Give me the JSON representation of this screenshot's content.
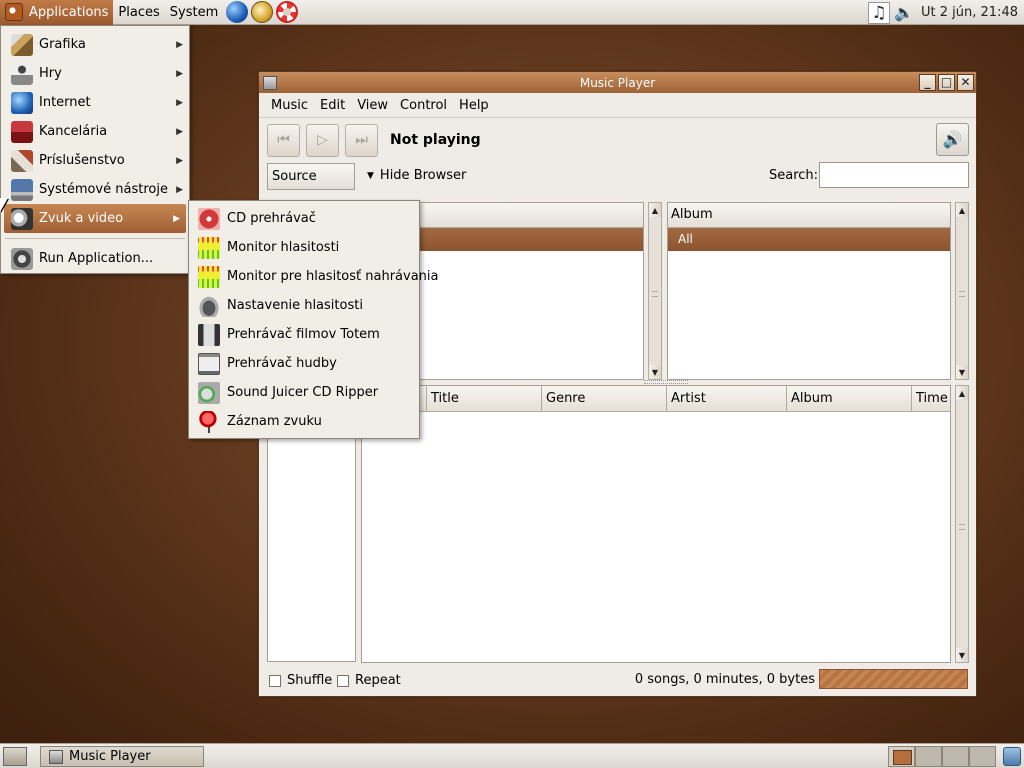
{
  "top_panel": {
    "menus": [
      "Applications",
      "Places",
      "System"
    ],
    "launchers": [
      "globe-icon",
      "mail-icon",
      "help-icon"
    ],
    "tray_icons": [
      "music-note-icon",
      "volume-icon"
    ],
    "clock": "Ut  2 jún, 21:48"
  },
  "apps_menu": {
    "items": [
      {
        "label": "Grafika",
        "icon": "graphics-icon",
        "submenu": true
      },
      {
        "label": "Hry",
        "icon": "games-icon",
        "submenu": true
      },
      {
        "label": "Internet",
        "icon": "internet-icon",
        "submenu": true
      },
      {
        "label": "Kancelária",
        "icon": "office-icon",
        "submenu": true
      },
      {
        "label": "Príslušenstvo",
        "icon": "accessories-icon",
        "submenu": true
      },
      {
        "label": "Systémové nástroje",
        "icon": "system-tools-icon",
        "submenu": true
      },
      {
        "label": "Zvuk a video",
        "icon": "sound-video-icon",
        "submenu": true,
        "selected": true
      }
    ],
    "run_label": "Run Application..."
  },
  "sound_video_menu": {
    "items": [
      {
        "label": "CD prehrávač",
        "icon": "cd-player-icon"
      },
      {
        "label": "Monitor hlasitosti",
        "icon": "volume-monitor-icon"
      },
      {
        "label": "Monitor pre hlasitosť nahrávania",
        "icon": "record-monitor-icon"
      },
      {
        "label": "Nastavenie hlasitosti",
        "icon": "volume-control-icon"
      },
      {
        "label": "Prehrávač filmov Totem",
        "icon": "totem-icon"
      },
      {
        "label": "Prehrávač hudby",
        "icon": "music-player-icon"
      },
      {
        "label": "Sound Juicer CD Ripper",
        "icon": "sound-juicer-icon"
      },
      {
        "label": "Záznam zvuku",
        "icon": "sound-recorder-icon"
      }
    ]
  },
  "window": {
    "title": "Music Player",
    "menubar": [
      "Music",
      "Edit",
      "View",
      "Control",
      "Help"
    ],
    "status_text": "Not playing",
    "source_header": "Source",
    "hide_browser": "Hide Browser",
    "search_label": "Search:",
    "search_value": "",
    "artist_selected": "",
    "album_header": "Album",
    "album_selected": "All",
    "track_columns": [
      "",
      "Title",
      "Genre",
      "Artist",
      "Album",
      "Time"
    ],
    "shuffle_label": "Shuffle",
    "repeat_label": "Repeat",
    "song_status": "0 songs, 0 minutes, 0 bytes"
  },
  "bottom_panel": {
    "task_label": "Music Player",
    "workspaces": 4,
    "active_workspace": 1
  },
  "colors": {
    "accent": "#a26a42",
    "selection": "#9f5f33",
    "panel": "#e6e1da"
  }
}
